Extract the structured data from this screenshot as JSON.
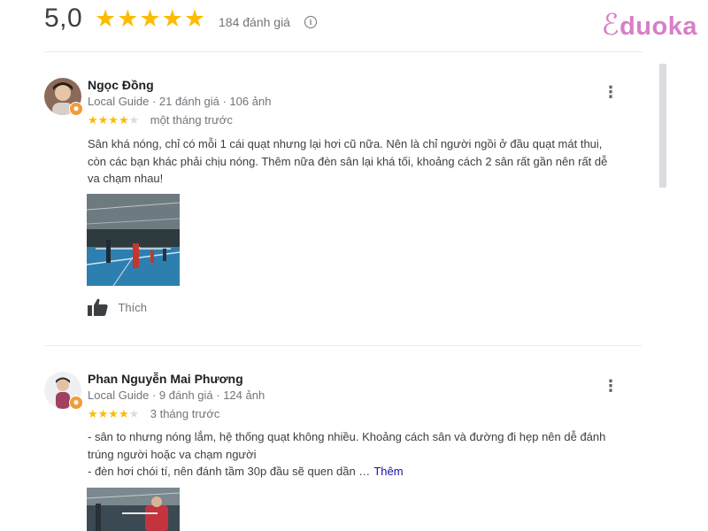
{
  "header": {
    "rating": "5,0",
    "stars": "★★★★★",
    "review_count": "184 đánh giá",
    "info_icon": "info-icon",
    "brand": "Eduoka"
  },
  "reviews": [
    {
      "name": "Ngọc Đồng",
      "meta": "Local Guide · 21 đánh giá · 106 ảnh",
      "rating": 4,
      "time": "một tháng trước",
      "text_lines": [
        "Sân khá nóng, chỉ có mỗi 1 cái quạt nhưng lại hơi cũ nữa. Nên là chỉ người ngồi ở đầu quạt mát thui,",
        "còn các bạn khác phải chịu nóng. Thêm nữa đèn sân lại khá tối, khoảng cách 2 sân rất gần nên rất dễ",
        "va chạm nhau!"
      ],
      "like_label": "Thích"
    },
    {
      "name": "Phan Nguyễn Mai Phương",
      "meta": "Local Guide · 9 đánh giá · 124 ảnh",
      "rating": 4,
      "time": "3 tháng trước",
      "text_lines": [
        "- sân to nhưng nóng lắm, hệ thống quạt không nhiều. Khoảng cách sân và đường đi hẹp nên dễ đánh",
        "trúng người hoặc va chạm người",
        "- đèn hơi chói tí, nên đánh tầm 30p đầu sẽ quen dần …"
      ],
      "more_label": "Thêm"
    }
  ],
  "colors": {
    "star": "#fbbc04",
    "brand": "#d77fc7",
    "link": "#1a0dab"
  }
}
